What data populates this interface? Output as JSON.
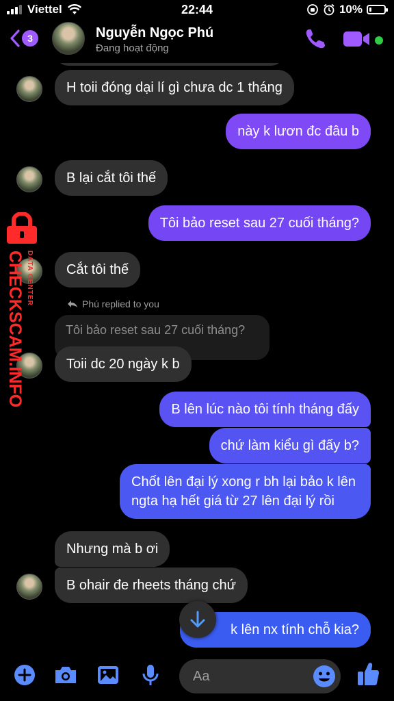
{
  "status_bar": {
    "carrier": "Viettel",
    "time": "22:44",
    "battery_percent": "10%"
  },
  "header": {
    "back_badge_count": "3",
    "contact_name": "Nguyễn Ngọc Phú",
    "contact_status": "Đang hoạt động"
  },
  "messages": [
    {
      "side": "in",
      "text": "H toii đóng dại lí gì chưa dc 1 tháng"
    },
    {
      "side": "out",
      "text": "này k lươn đc đâu b"
    },
    {
      "side": "in",
      "text": "B lại cắt tôi thế"
    },
    {
      "side": "out",
      "text": "Tôi bảo reset sau 27 cuối tháng?"
    },
    {
      "side": "in",
      "text": "Cắt tôi thế"
    },
    {
      "side": "in",
      "reply_label": "Phú replied to you",
      "quoted": "Tôi bảo reset sau 27 cuối tháng?",
      "text": "Toii dc 20 ngày k b"
    },
    {
      "side": "out",
      "text": "B lên lúc nào tôi tính tháng đấy"
    },
    {
      "side": "out",
      "text": "chứ làm kiểu gì đấy b?"
    },
    {
      "side": "out",
      "line1": "Chốt lên đại lý xong r bh lại bảo k lên",
      "line2": "ngta hạ hết giá từ 27 lên đại lý rồi"
    },
    {
      "side": "in",
      "text": "Nhưng mà b ơi"
    },
    {
      "side": "in",
      "text": "B ohair đe rheets tháng chứ"
    },
    {
      "side": "out",
      "text_start": "t",
      "text_end": "k lên nx tính chỗ kia?"
    }
  ],
  "watermark": {
    "main": "CHECKSCAM.INFO",
    "sub": "DATA CENTER"
  },
  "composer": {
    "placeholder": "Aa"
  },
  "colors": {
    "accent": "#9f5bff",
    "incoming_bubble": "#303030",
    "outgoing_top": "#8a42f5",
    "outgoing_bottom": "#3b5cf0",
    "online": "#31cc46",
    "watermark": "#ff2a2a"
  }
}
